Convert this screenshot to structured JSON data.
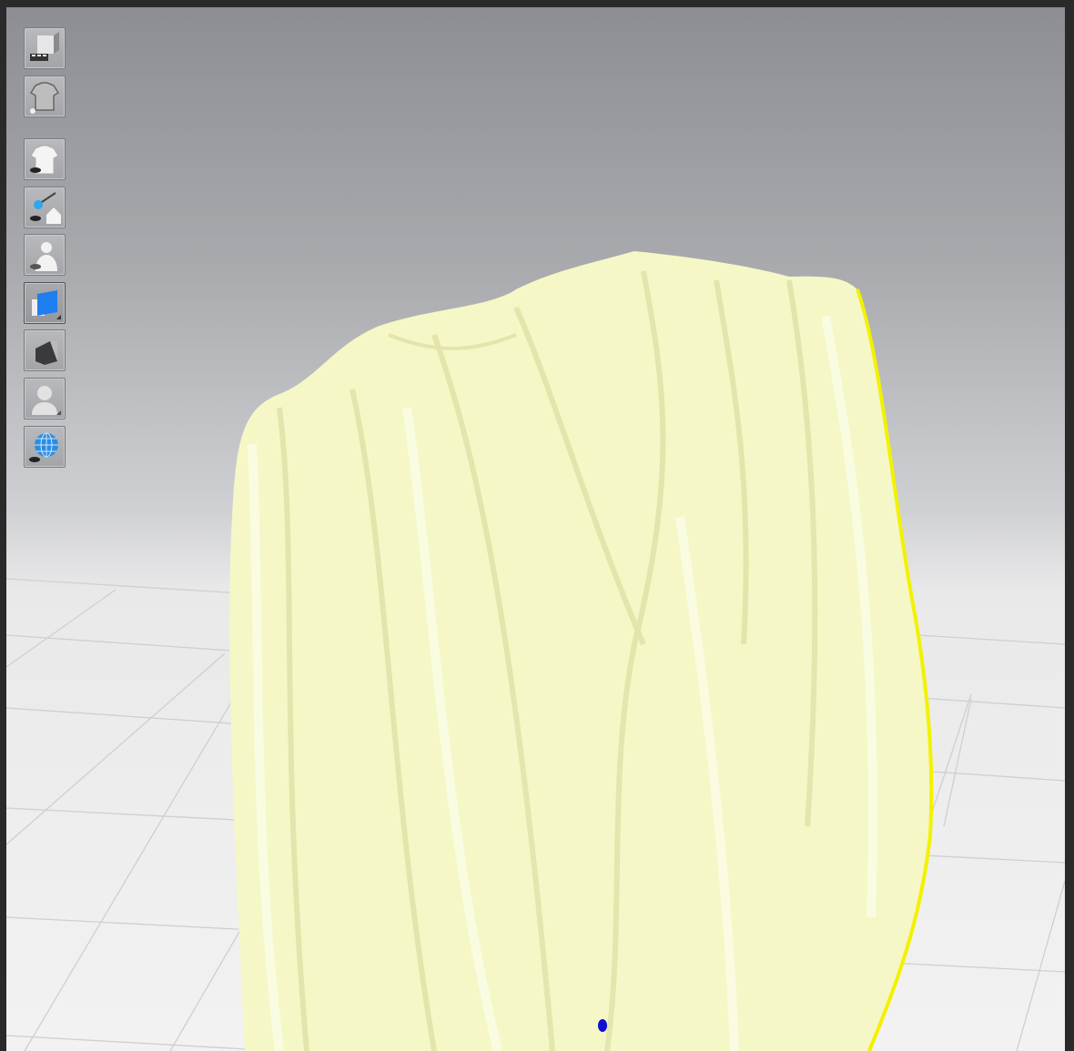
{
  "viewport": {
    "background_top": "#8d8e93",
    "floor_color": "#f2f2f2",
    "cloth_color": "#f5f7c6",
    "cloth_selected_edge": "#f2f200",
    "pin_point_color": "#1010d0"
  },
  "toolbar": {
    "groups": [
      [
        {
          "icon": "simulation-scene-icon"
        },
        {
          "icon": "garment-quality-icon"
        }
      ],
      [
        {
          "icon": "show-garment-icon"
        },
        {
          "icon": "show-pins-icon"
        },
        {
          "icon": "show-avatar-icon"
        },
        {
          "icon": "texture-surface-icon",
          "active": true
        },
        {
          "icon": "shaded-surface-icon"
        },
        {
          "icon": "avatar-silhouette-icon"
        },
        {
          "icon": "show-mesh-icon"
        }
      ]
    ]
  }
}
